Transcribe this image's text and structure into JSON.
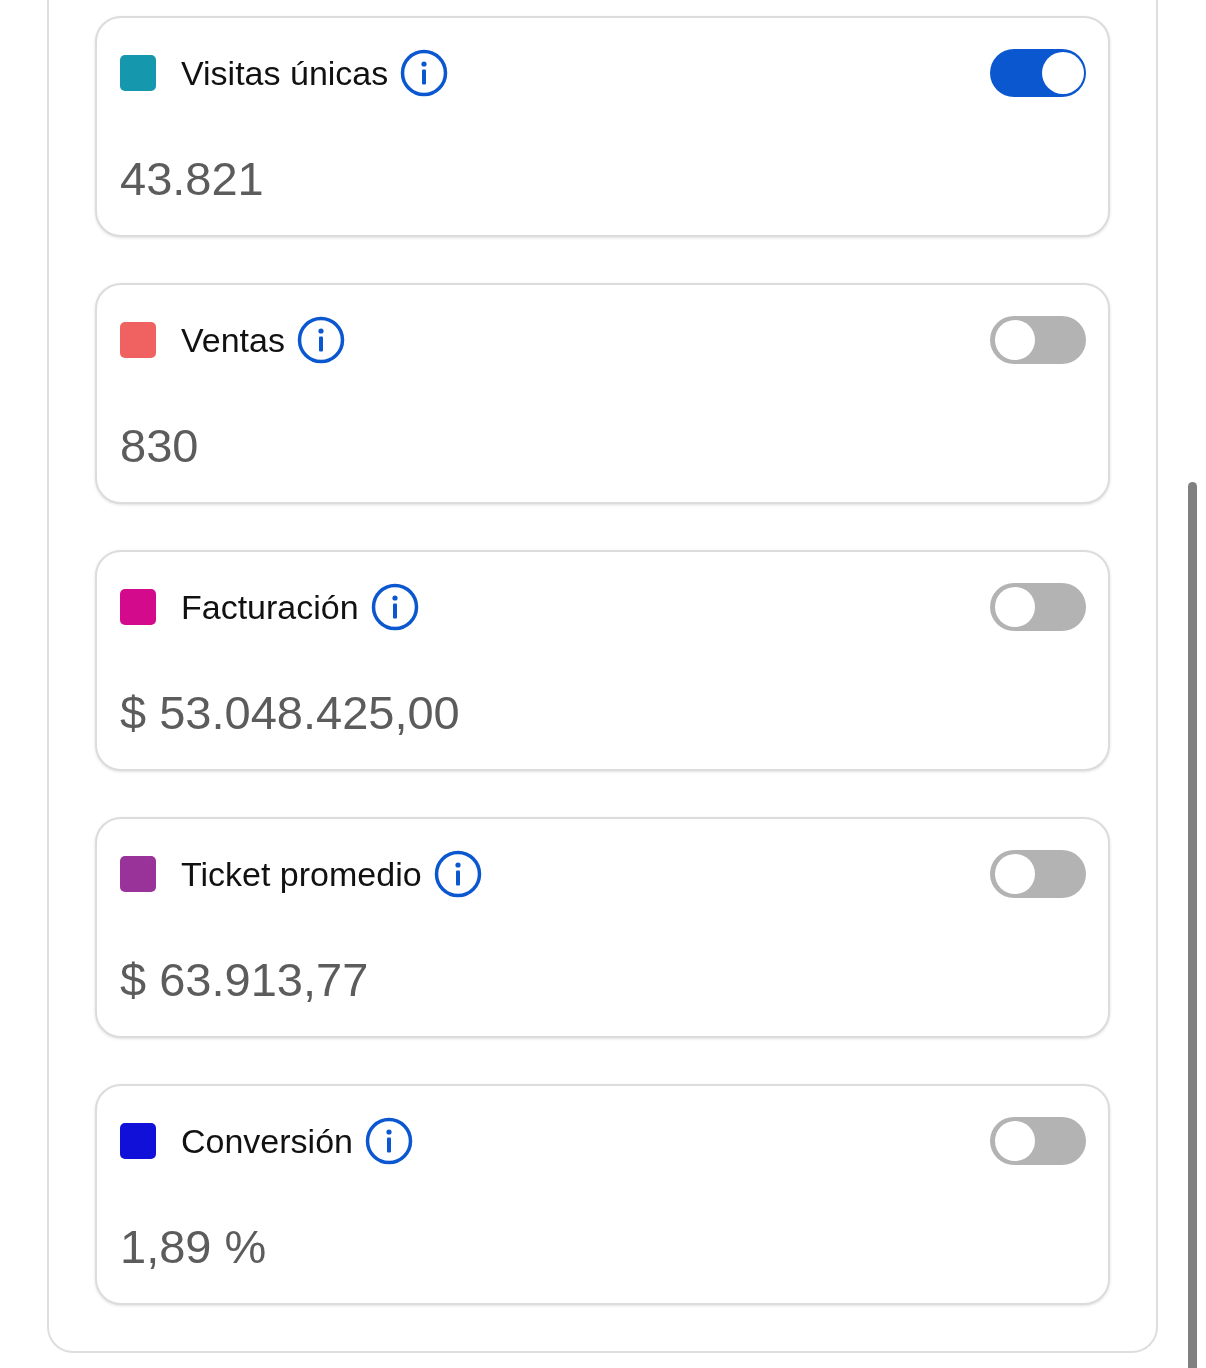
{
  "metrics": [
    {
      "label": "Visitas únicas",
      "value": "43.821",
      "color": "#1597ae",
      "on": true
    },
    {
      "label": "Ventas",
      "value": "830",
      "color": "#f06262",
      "on": false
    },
    {
      "label": "Facturación",
      "value": "$ 53.048.425,00",
      "color": "#d40a8c",
      "on": false
    },
    {
      "label": "Ticket promedio",
      "value": "$ 63.913,77",
      "color": "#993399",
      "on": false
    },
    {
      "label": "Conversión",
      "value": "1,89 %",
      "color": "#1010d8",
      "on": false
    }
  ]
}
